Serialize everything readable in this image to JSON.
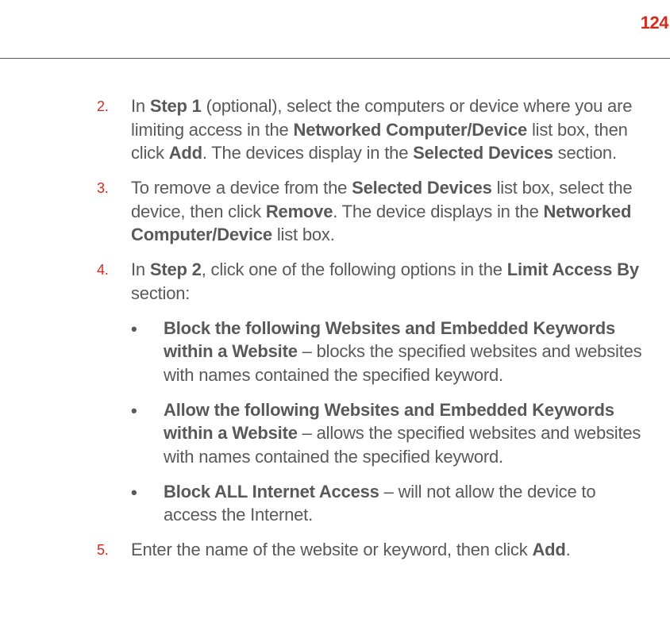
{
  "page_number": "124",
  "items": {
    "item2": {
      "number": "2.",
      "text_prefix": "In ",
      "bold1": "Step 1",
      "text_after_bold1": " (optional), select the computers or device where you are limiting access in the ",
      "bold2": "Networked Computer/Device",
      "text_after_bold2": " list box, then click ",
      "bold3": "Add",
      "text_after_bold3": ". The devices display in the ",
      "bold4": "Selected Devices",
      "text_after_bold4": " section."
    },
    "item3": {
      "number": "3.",
      "text_prefix": "To remove a device from the ",
      "bold1": "Selected Devices",
      "text_after_bold1": " list box, select the device, then click ",
      "bold2": "Remove",
      "text_after_bold2": ". The device displays in the ",
      "bold3": "Networked Computer/Device",
      "text_after_bold3": " list box."
    },
    "item4": {
      "number": "4.",
      "text_prefix": "In ",
      "bold1": "Step 2",
      "text_after_bold1": ", click one of the following options in the ",
      "bold2": "Limit Access By",
      "text_after_bold2": " section:"
    },
    "bullet1": {
      "mark": "•",
      "bold": "Block the following Websites and Embedded Keywords within a Website",
      "rest": " – blocks the specified websites and websites with names contained the specified keyword."
    },
    "bullet2": {
      "mark": "•",
      "bold": "Allow the following Websites and Embedded Keywords within a Website",
      "rest": " – allows the specified websites and websites with names contained the specified keyword."
    },
    "bullet3": {
      "mark": "•",
      "bold": "Block ALL Internet Access",
      "rest": " – will not allow the device to access the Internet."
    },
    "item5": {
      "number": "5.",
      "text_prefix": "Enter the name of the website or keyword, then click ",
      "bold1": "Add",
      "text_after_bold1": "."
    }
  }
}
